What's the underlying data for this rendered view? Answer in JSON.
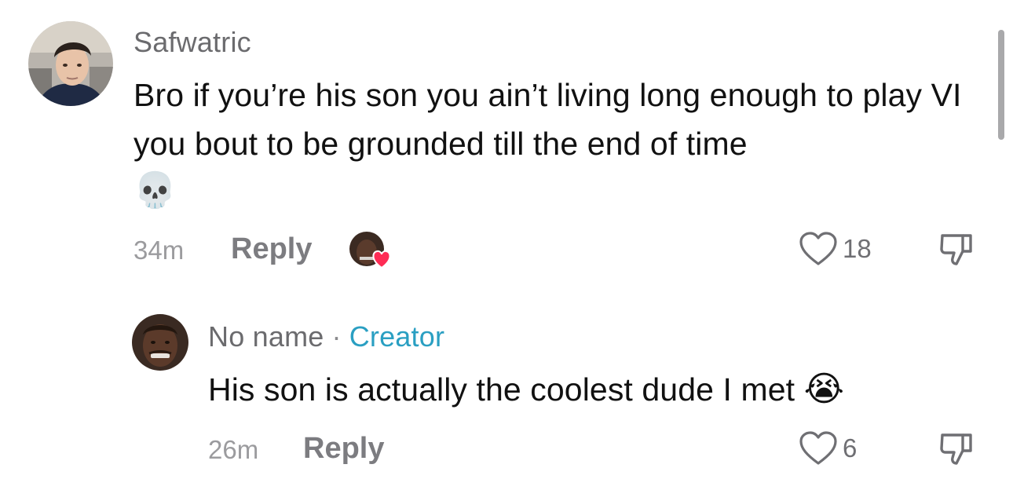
{
  "comments": [
    {
      "username": "Safwatric",
      "text": "Bro if you’re his son you ain’t living long enough to play VI you bout to be grounded till the end of time",
      "emoji": "💀",
      "time": "34m",
      "reply_label": "Reply",
      "likes": "18",
      "liked_by_creator": true,
      "icons": {
        "like": "heart-outline-icon",
        "dislike": "thumbs-down-icon",
        "creator_like": "creator-liked-heart-icon"
      }
    },
    {
      "username": "No name",
      "separator": "·",
      "tag": "Creator",
      "text": "His son is actually the coolest dude I met",
      "emoji": "😭",
      "time": "26m",
      "reply_label": "Reply",
      "likes": "6",
      "icons": {
        "like": "heart-outline-icon",
        "dislike": "thumbs-down-icon"
      }
    }
  ],
  "colors": {
    "creator_tag": "#2a9fc2",
    "creator_heart": "#fe2c55",
    "secondary_text": "#6b6b6e"
  }
}
